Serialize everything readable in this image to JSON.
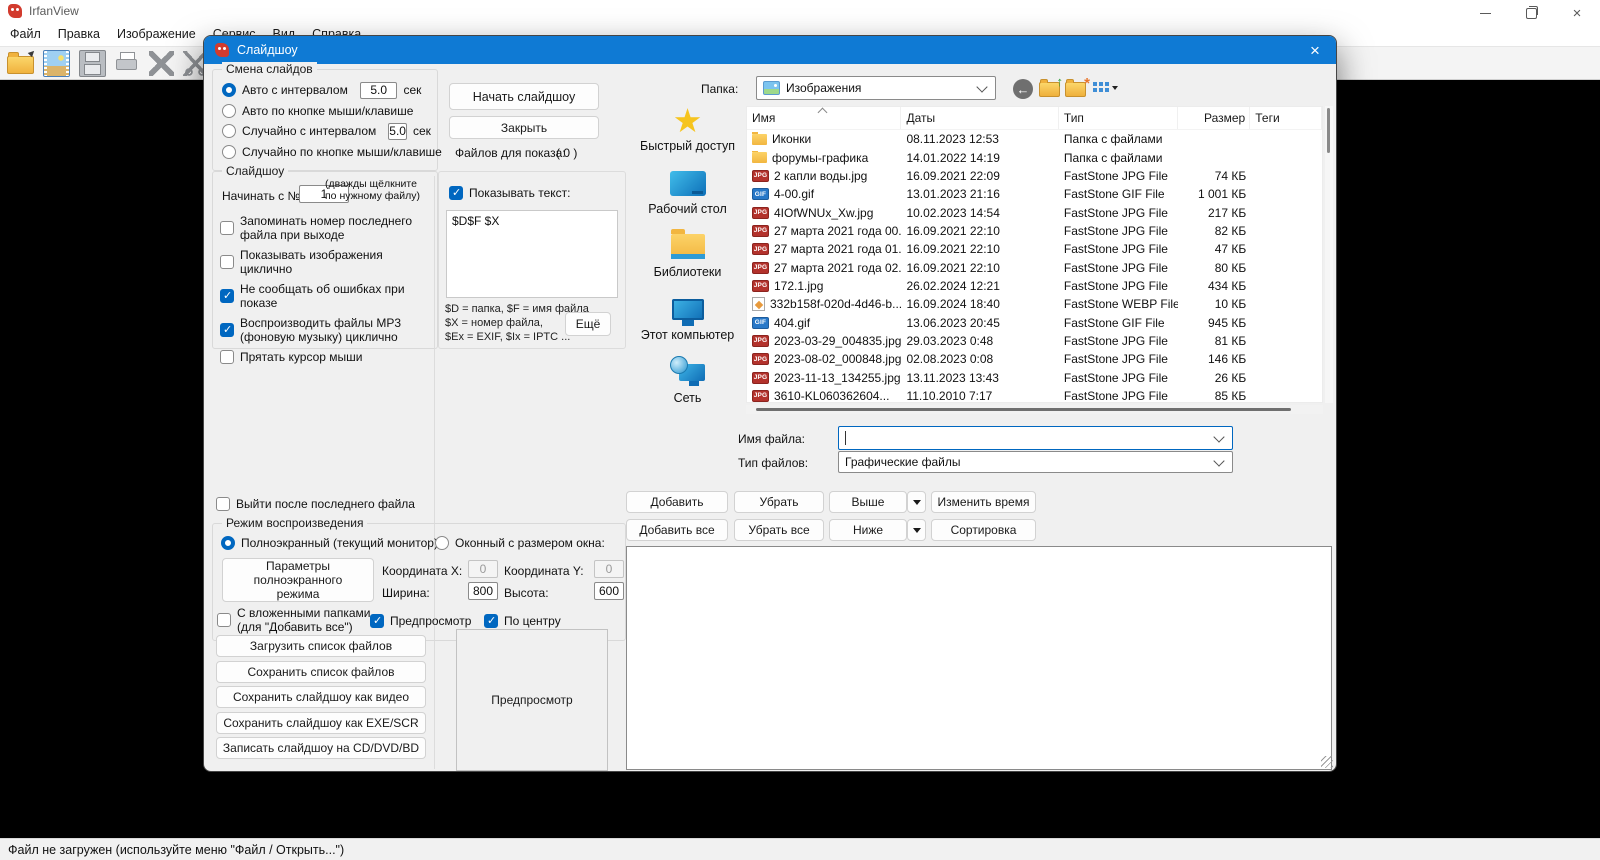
{
  "colors": {
    "accent": "#0067c0",
    "dialog_titlebar": "#0f7ad4",
    "canvas": "#000000",
    "folder_icon": "#f2b640",
    "jpg_badge": "#b3322c",
    "gif_badge": "#2878c8"
  },
  "app": {
    "title": "IrfanView",
    "menu": [
      "Файл",
      "Правка",
      "Изображение",
      "Сервис",
      "Вид",
      "Справка"
    ],
    "toolbar_icons": [
      "open-folder-icon",
      "slideshow-icon",
      "save-icon",
      "print-icon",
      "delete-icon",
      "cut-icon",
      "copy-icon"
    ],
    "status": "Файл не загружен (используйте меню \"Файл / Открыть...\")"
  },
  "dialog": {
    "title": "Слайдшоу",
    "slide_change": {
      "title": "Смена слайдов",
      "options": [
        {
          "label": "Авто с интервалом",
          "selected": true,
          "value": "5.0",
          "unit": "сек"
        },
        {
          "label": "Авто по кнопке мыши/клавише",
          "selected": false
        },
        {
          "label": "Случайно с интервалом",
          "selected": false,
          "value": "5.0",
          "unit": "сек"
        },
        {
          "label": "Случайно по кнопке мыши/клавише",
          "selected": false
        }
      ]
    },
    "actions": {
      "start": "Начать слайдшоу",
      "close": "Закрыть",
      "files_to_show_label": "Файлов для показа:",
      "files_to_show_value": "( 0 )"
    },
    "slideshow_group": {
      "title": "Слайдшоу",
      "start_with_label": "Начинать с №",
      "start_with_value": "1",
      "start_with_hints": [
        "(дважды щёлкните",
        "по нужному файлу)"
      ],
      "checkboxes": [
        {
          "lines": [
            "Запоминать номер последнего",
            "файла при выходе"
          ],
          "checked": false
        },
        {
          "lines": [
            "Показывать изображения циклично"
          ],
          "checked": false
        },
        {
          "lines": [
            "Не сообщать об ошибках при показе"
          ],
          "checked": true
        },
        {
          "lines": [
            "Воспроизводить файлы MP3",
            "(фоновую музыку) циклично"
          ],
          "checked": true
        },
        {
          "lines": [
            "Прятать курсор мыши"
          ],
          "checked": false
        }
      ]
    },
    "text_overlay": {
      "show_text_label": "Показывать текст:",
      "checked": true,
      "text_value": "$D$F $X",
      "hint_lines": [
        "$D = папка, $F = имя файла",
        "$X = номер файла,",
        "$Ex = EXIF, $Ix = IPTC ..."
      ],
      "more_button": "Ещё"
    },
    "exit_after_last": {
      "label": "Выйти после последнего файла",
      "checked": false
    },
    "playback": {
      "title": "Режим воспроизведения",
      "fullscreen_label": "Полноэкранный (текущий монитор)",
      "fullscreen_selected": true,
      "windowed_label": "Оконный с размером окна:",
      "windowed_selected": false,
      "params_lines": [
        "Параметры полноэкранного",
        "режима"
      ],
      "coord_x_label": "Координата X:",
      "coord_x_value": "0",
      "coord_y_label": "Координата Y:",
      "coord_y_value": "0",
      "width_label": "Ширина:",
      "width_value": "800",
      "height_label": "Высота:",
      "height_value": "600",
      "subfolders_lines": [
        "С вложенными папками",
        "(для \"Добавить все\")"
      ],
      "subfolders_checked": false,
      "preview_label": "Предпросмотр",
      "preview_checked": true,
      "center_label": "По центру",
      "center_checked": true
    },
    "file_buttons": [
      "Загрузить список файлов",
      "Сохранить список файлов",
      "Сохранить слайдшоу как видео",
      "Сохранить слайдшоу как EXE/SCR",
      "Записать слайдшоу на CD/DVD/BD"
    ],
    "preview_box_label": "Предпросмотр",
    "list_actions": {
      "row1": [
        {
          "label": "Добавить"
        },
        {
          "label": "Убрать"
        },
        {
          "label": "Выше",
          "split": true
        },
        {
          "label": "Изменить время"
        }
      ],
      "row2": [
        {
          "label": "Добавить все"
        },
        {
          "label": "Убрать все"
        },
        {
          "label": "Ниже",
          "split": true
        },
        {
          "label": "Сортировка"
        }
      ]
    }
  },
  "explorer": {
    "folder_label": "Папка:",
    "folder_value": "Изображения",
    "nav_icons": [
      "back-icon",
      "up-folder-icon",
      "new-folder-icon",
      "views-icon"
    ],
    "places": [
      {
        "icon": "star",
        "label": "Быстрый доступ"
      },
      {
        "icon": "desktop",
        "label": "Рабочий стол"
      },
      {
        "icon": "libraries",
        "label": "Библиотеки"
      },
      {
        "icon": "computer",
        "label": "Этот компьютер"
      },
      {
        "icon": "network",
        "label": "Сеть"
      }
    ],
    "columns": [
      "Имя",
      "Даты",
      "Тип",
      "Размер",
      "Теги"
    ],
    "files": [
      {
        "icon": "folder",
        "name": "Иконки",
        "date": "08.11.2023 12:53",
        "type": "Папка с файлами",
        "size": ""
      },
      {
        "icon": "folder",
        "name": "форумы-графика",
        "date": "14.01.2022 14:19",
        "type": "Папка с файлами",
        "size": ""
      },
      {
        "icon": "jpg",
        "name": "2 капли воды.jpg",
        "date": "16.09.2021 22:09",
        "type": "FastStone JPG File",
        "size": "74 КБ"
      },
      {
        "icon": "gif",
        "name": "4-00.gif",
        "date": "13.01.2023 21:16",
        "type": "FastStone GIF File",
        "size": "1 001 КБ"
      },
      {
        "icon": "jpg",
        "name": "4IOfWNUx_Xw.jpg",
        "date": "10.02.2023 14:54",
        "type": "FastStone JPG File",
        "size": "217 КБ"
      },
      {
        "icon": "jpg",
        "name": "27 марта 2021 года 00...",
        "date": "16.09.2021 22:10",
        "type": "FastStone JPG File",
        "size": "82 КБ"
      },
      {
        "icon": "jpg",
        "name": "27 марта 2021 года 01...",
        "date": "16.09.2021 22:10",
        "type": "FastStone JPG File",
        "size": "47 КБ"
      },
      {
        "icon": "jpg",
        "name": "27 марта 2021 года 02...",
        "date": "16.09.2021 22:10",
        "type": "FastStone JPG File",
        "size": "80 КБ"
      },
      {
        "icon": "jpg",
        "name": "172.1.jpg",
        "date": "26.02.2024 12:21",
        "type": "FastStone JPG File",
        "size": "434 КБ"
      },
      {
        "icon": "webp",
        "name": "332b158f-020d-4d46-b...",
        "date": "16.09.2024 18:40",
        "type": "FastStone WEBP File",
        "size": "10 КБ"
      },
      {
        "icon": "gif",
        "name": "404.gif",
        "date": "13.06.2023 20:45",
        "type": "FastStone GIF File",
        "size": "945 КБ"
      },
      {
        "icon": "jpg",
        "name": "2023-03-29_004835.jpg",
        "date": "29.03.2023 0:48",
        "type": "FastStone JPG File",
        "size": "81 КБ"
      },
      {
        "icon": "jpg",
        "name": "2023-08-02_000848.jpg",
        "date": "02.08.2023 0:08",
        "type": "FastStone JPG File",
        "size": "146 КБ"
      },
      {
        "icon": "jpg",
        "name": "2023-11-13_134255.jpg",
        "date": "13.11.2023 13:43",
        "type": "FastStone JPG File",
        "size": "26 КБ"
      },
      {
        "icon": "jpg",
        "name": "3610-KL060362604...",
        "date": "11.10.2010 7:17",
        "type": "FastStone JPG File",
        "size": "85 КБ"
      }
    ],
    "file_name_label": "Имя файла:",
    "file_name_value": "",
    "file_type_label": "Тип файлов:",
    "file_type_value": "Графические файлы"
  }
}
